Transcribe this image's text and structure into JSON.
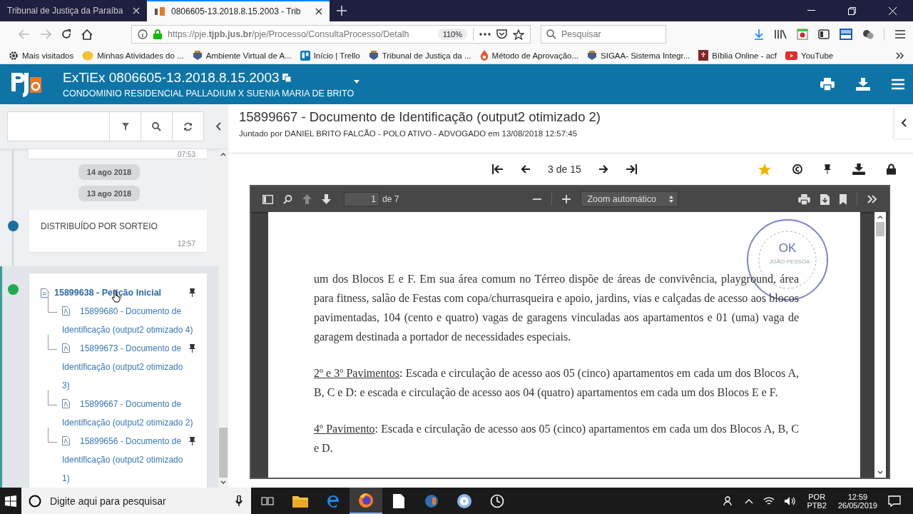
{
  "browser": {
    "tabs": [
      {
        "title": "Tribunal de Justiça da Paraíba",
        "selected": false
      },
      {
        "title": "0806605-13.2018.8.15.2003 - Trib",
        "selected": true
      }
    ],
    "url": "https://pje.**tjpb.jus.br**/pje/Processo/ConsultaProcesso/Detalh",
    "zoom": "110%",
    "search": {
      "placeholder": "Pesquisar"
    },
    "bookmarks": [
      {
        "label": "Mais visitados",
        "kind": "gear"
      },
      {
        "label": "Minhas Atividades do ...",
        "kind": "avatar"
      },
      {
        "label": "Ambiente Virtual de A...",
        "kind": "emblem"
      },
      {
        "label": "Início | Trello",
        "kind": "trello"
      },
      {
        "label": "Tribunal de Justiça da ...",
        "kind": "emblem"
      },
      {
        "label": "Método de Aprovação...",
        "kind": "flame"
      },
      {
        "label": "SIGAA- Sistema Integr...",
        "kind": "emblem"
      },
      {
        "label": "Bíblia Online - acf",
        "kind": "book"
      },
      {
        "label": "YouTube",
        "kind": "youtube"
      }
    ]
  },
  "header": {
    "process": "ExTiEx 0806605-13.2018.8.15.2003",
    "parties": "CONDOMINIO RESIDENCIAL PALLADIUM X SUENIA MARIA DE BRITO"
  },
  "timeline": [
    {
      "kind": "time_only",
      "time": "07:53"
    },
    {
      "kind": "date",
      "label": "14 ago 2018"
    },
    {
      "kind": "date",
      "label": "13 ago 2018"
    },
    {
      "kind": "event",
      "text": "DISTRIBUÍDO POR SORTEIO",
      "time": "12:57",
      "color": "#1a6fa0",
      "selected": false
    },
    {
      "kind": "documents",
      "color": "#22a94f",
      "selected": true,
      "document": {
        "title": "15899638 - Petição Inicial",
        "pinned": true,
        "children": [
          {
            "title": "15899680 - Documento de Identificação (output2 otimizado 4)",
            "pinned": false
          },
          {
            "title": "15899673 - Documento de Identificação (output2 otimizado 3)",
            "pinned": true
          },
          {
            "title": "15899667 - Documento de Identificação (output2 otimizado 2)",
            "pinned": false
          },
          {
            "title": "15899656 - Documento de Identificação (output2 otimizado 1)",
            "pinned": true
          }
        ]
      }
    }
  ],
  "document": {
    "title": "15899667 - Documento de Identificação (output2 otimizado 2)",
    "subtitle": "Juntado por DANIEL BRITO FALCÃO - POLO ATIVO - ADVOGADO em 13/08/2018 12:57:45",
    "pager": "3 de 15",
    "favorite": true
  },
  "viewer": {
    "page": "1",
    "pages": "de 7",
    "zoom": "Zoom automático",
    "stamp": {
      "mark": "OK",
      "city": "JOÃO PESSOA"
    },
    "paragraphs": [
      {
        "text": "um dos Blocos E e F. Em sua área comum no Térreo dispõe de áreas de convivência, playground, área para fitness, salão de Festas com copa/churrasqueira e apoio, jardins, vias e calçadas de acesso aos blocos pavimentadas, 104 (cento e quatro) vagas de garagens vinculadas aos apartamentos e 01 (uma) vaga de garagem destinada a portador de necessidades especiais."
      },
      {
        "heading": "2º e 3º Pavimentos",
        "text": ": Escada e circulação de acesso aos 05 (cinco) apartamentos em cada um dos Blocos A, B, C e D: e escada e circulação de acesso aos 04 (quatro) apartamentos em cada um dos Blocos E e F."
      },
      {
        "heading": "4º Pavimento",
        "text": ": Escada e circulação de acesso aos 05 (cinco) apartamentos em cada um dos Blocos A, B, C e D."
      }
    ]
  },
  "taskbar": {
    "search": {
      "placeholder": "Digite aqui para pesquisar"
    },
    "apps": [
      {
        "kind": "taskview",
        "active": false
      },
      {
        "kind": "folder",
        "active": false
      },
      {
        "kind": "edge",
        "active": false
      },
      {
        "kind": "firefox",
        "active": true
      },
      {
        "kind": "file",
        "active": false
      },
      {
        "kind": "pje",
        "active": false
      },
      {
        "kind": "film",
        "active": false
      },
      {
        "kind": "clock",
        "active": false
      }
    ],
    "language": "POR",
    "layout": "PTB2",
    "time": "12:59",
    "date": "26/05/2019"
  }
}
